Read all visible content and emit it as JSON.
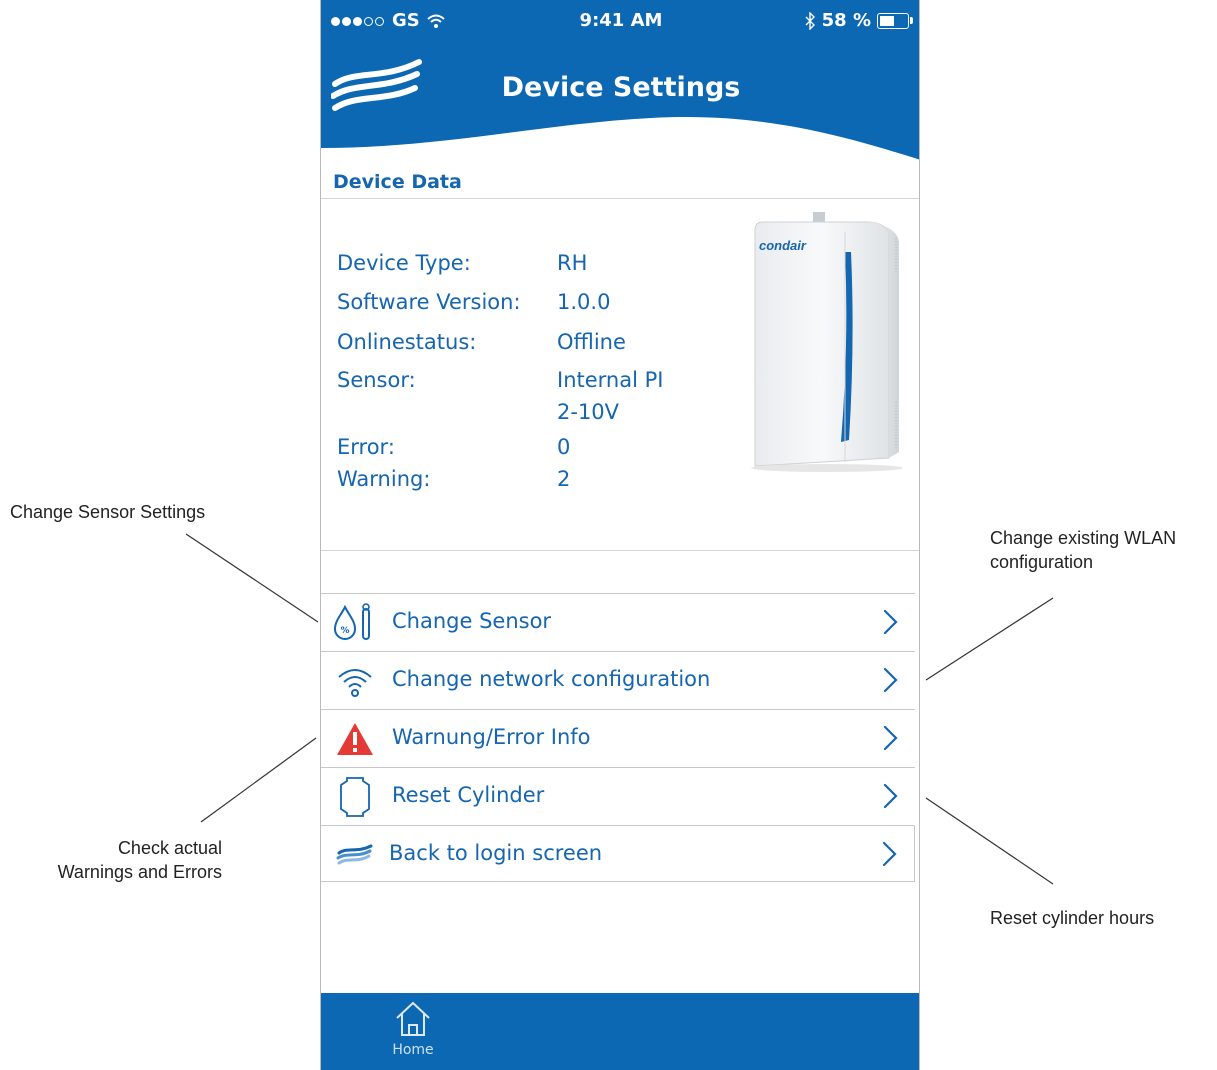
{
  "status_bar": {
    "carrier": "GS",
    "time": "9:41 AM",
    "battery": "58 %",
    "battery_level": 0.58
  },
  "header": {
    "title": "Device Settings"
  },
  "device_data": {
    "title": "Device Data",
    "rows": [
      {
        "label": "Device Type:",
        "value": "RH"
      },
      {
        "label": "Software Version:",
        "value": "1.0.0"
      },
      {
        "label": "Onlinestatus:",
        "value": "Offline"
      },
      {
        "label": "Sensor:",
        "value": "Internal PI",
        "value2": "2-10V"
      },
      {
        "label": "Error:",
        "value": "0"
      },
      {
        "label": "Warning:",
        "value": "2"
      }
    ],
    "device_brand": "condair"
  },
  "menu": [
    {
      "label": "Change Sensor",
      "icon": "humidity-sensor-icon"
    },
    {
      "label": "Change network configuration",
      "icon": "wifi-icon"
    },
    {
      "label": "Warnung/Error Info",
      "icon": "warning-icon"
    },
    {
      "label": "Reset Cylinder",
      "icon": "cylinder-icon"
    },
    {
      "label": "Back to login screen",
      "icon": "wave-logo-icon"
    }
  ],
  "tab_bar": {
    "home_label": "Home"
  },
  "callouts": {
    "change_sensor": "Change Sensor Settings",
    "wlan_line1": "Change existing WLAN",
    "wlan_line2": "configuration",
    "warnings_line1": "Check actual",
    "warnings_line2": "Warnings and Errors",
    "reset": "Reset cylinder hours"
  },
  "colors": {
    "brand_blue": "#0c68b3",
    "text_blue": "#1565b0",
    "warning_red": "#e53935"
  }
}
